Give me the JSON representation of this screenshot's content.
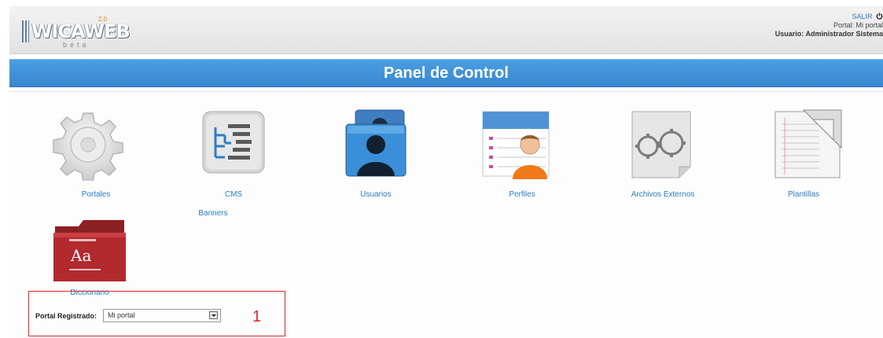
{
  "header": {
    "logo_text": "WICAWEB",
    "logo_version": "2.0",
    "logo_tag": "beta",
    "logout_label": "SALIR",
    "portal_line": "Portal: Mi portal",
    "user_line": "Usuario: Administrador Sistema"
  },
  "page": {
    "title": "Panel de Control"
  },
  "modules": {
    "portales": "Portales",
    "cms": "CMS",
    "banners": "Banners",
    "usuarios": "Usuarios",
    "perfiles": "Perfiles",
    "archivos": "Archivos Externos",
    "plantillas": "Plantillas",
    "diccionario": "Diccionario",
    "diccionario_book_text": "Aa"
  },
  "portal_selector": {
    "label": "Portal Registrado:",
    "selected": "Mi portal"
  },
  "annotation": {
    "step": "1"
  },
  "colors": {
    "accent": "#3a86cf",
    "link": "#2a7cc7",
    "highlight": "#d9272e"
  }
}
